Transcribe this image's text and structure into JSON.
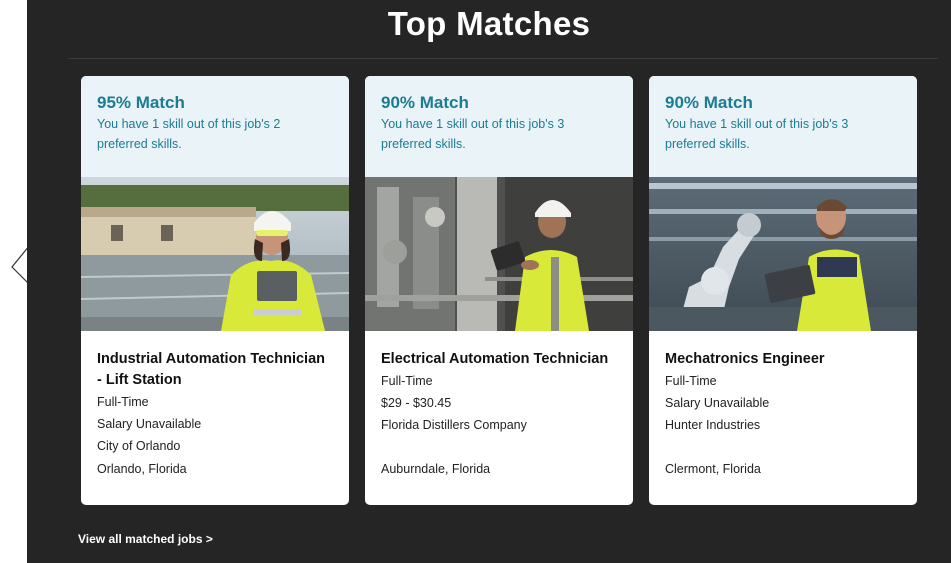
{
  "section": {
    "title": "Top Matches",
    "view_all_label": "View all matched jobs >"
  },
  "cards": [
    {
      "match": "95% Match",
      "skills": "You have 1 skill out of this job's 2 preferred skills.",
      "image_subject": "technician in hi-vis jacket and hard hat with tablet at water treatment plant",
      "job_title": "Industrial Automation Technician - Lift Station",
      "type": "Full-Time",
      "salary": "Salary Unavailable",
      "company": "City of Orlando",
      "location": "Orlando, Florida"
    },
    {
      "match": "90% Match",
      "skills": "You have 1 skill out of this job's 3 preferred skills.",
      "image_subject": "technician in hard hat with tablet among industrial piping",
      "job_title": "Electrical Automation Technician",
      "type": "Full-Time",
      "salary": "$29 - $30.45",
      "company": "Florida Distillers Company",
      "location": "Auburndale, Florida"
    },
    {
      "match": "90% Match",
      "skills": "You have 1 skill out of this job's 3 preferred skills.",
      "image_subject": "engineer with laptop next to robotic arm in factory",
      "job_title": "Mechatronics Engineer",
      "type": "Full-Time",
      "salary": "Salary Unavailable",
      "company": "Hunter Industries",
      "location": "Clermont, Florida"
    }
  ],
  "icons": {
    "prev": "chevron-left-icon"
  },
  "colors": {
    "panel_bg": "#252525",
    "card_header_bg": "#e9f3f8",
    "accent_teal": "#1b7c92",
    "hi_vis_yellow": "#d8e93a"
  }
}
